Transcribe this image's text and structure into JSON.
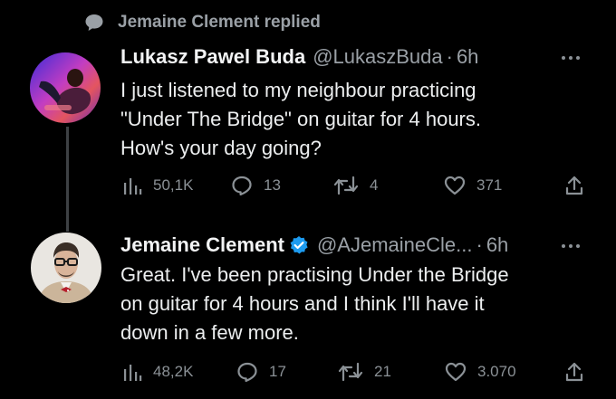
{
  "social_context": {
    "icon": "speech-bubble-icon",
    "text": "Jemaine Clement replied"
  },
  "tweets": [
    {
      "author": {
        "name": "Lukasz Pawel Buda",
        "handle": "@LukaszBuda",
        "time": "6h",
        "verified": false
      },
      "text_lines": [
        "I just listened to my neighbour practicing",
        "\"Under The Bridge\" on guitar for 4 hours.",
        "How's your day going?"
      ],
      "stats": {
        "views": "50,1K",
        "replies": "13",
        "retweets": "4",
        "likes": "371"
      }
    },
    {
      "author": {
        "name": "Jemaine Clement",
        "handle": "@AJemaineCle...",
        "time": "6h",
        "verified": true
      },
      "text_lines": [
        "Great. I've been practising Under the Bridge",
        "on guitar for 4 hours and I think I'll have it",
        "down in a few more."
      ],
      "stats": {
        "views": "48,2K",
        "replies": "17",
        "retweets": "21",
        "likes": "3.070"
      }
    }
  ],
  "separator": "·",
  "colors": {
    "background": "#000000",
    "primary_text": "#e7e9ea",
    "secondary_text": "#9aa0a6",
    "icon_gray": "#8b9196",
    "verified_blue": "#1d9bf0",
    "thread_line": "#3e4144"
  }
}
